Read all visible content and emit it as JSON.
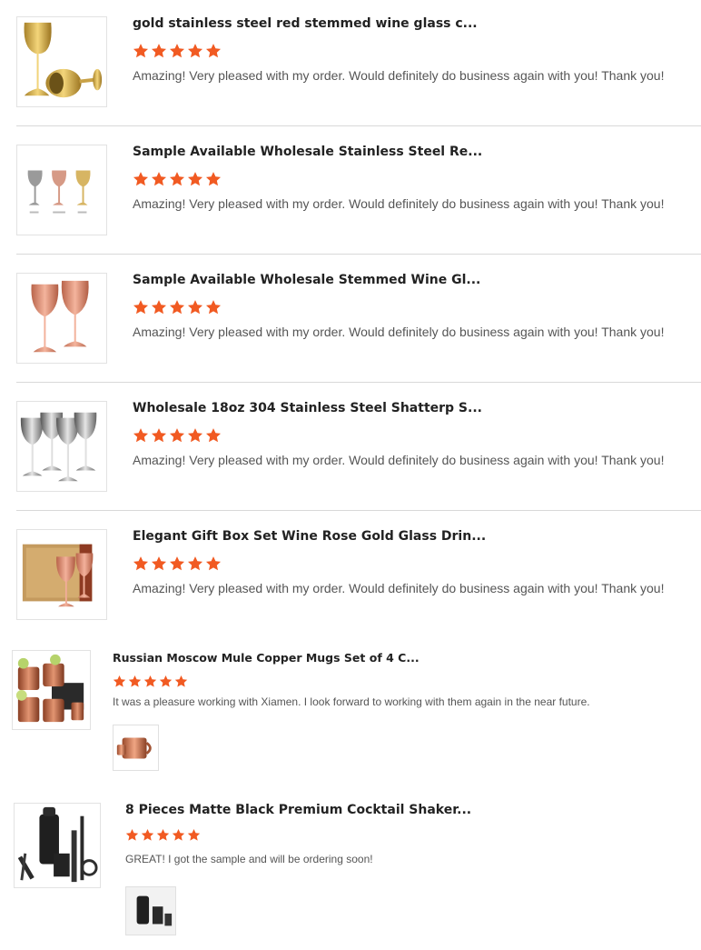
{
  "colors": {
    "star": "#f15a22",
    "divider": "#d9d9d9",
    "title": "#222222",
    "comment": "#555555"
  },
  "reviews": [
    {
      "title": "gold stainless steel red stemmed wine glass c...",
      "rating": 5,
      "comment": "Amazing! Very pleased with my order. Would definitely do business again with you! Thank you!",
      "image": "gold-wine-glasses-image"
    },
    {
      "title": "Sample Available Wholesale Stainless Steel Re...",
      "rating": 5,
      "comment": "Amazing! Very pleased with my order. Would definitely do business again with you! Thank you!",
      "image": "three-wine-glasses-image"
    },
    {
      "title": "Sample Available Wholesale Stemmed Wine Gl...",
      "rating": 5,
      "comment": "Amazing! Very pleased with my order. Would definitely do business again with you! Thank you!",
      "image": "rose-gold-wine-glasses-image"
    },
    {
      "title": "Wholesale 18oz 304 Stainless Steel Shatterp S...",
      "rating": 5,
      "comment": "Amazing! Very pleased with my order. Would definitely do business again with you! Thank you!",
      "image": "silver-wine-glasses-image"
    },
    {
      "title": "Elegant Gift Box Set Wine Rose Gold Glass Drin...",
      "rating": 5,
      "comment": "Amazing! Very pleased with my order. Would definitely do business again with you! Thank you!",
      "image": "gift-box-wine-glasses-image"
    },
    {
      "title": "Russian Moscow Mule Copper Mugs Set of 4 C...",
      "rating": 5,
      "comment": "It was a pleasure working with Xiamen. I look forward to working with them again in the near future.",
      "image": "copper-mugs-image",
      "attachment": "copper-mug-attachment"
    },
    {
      "title": "8 Pieces Matte Black Premium Cocktail Shaker...",
      "rating": 5,
      "comment": "GREAT! I got the sample and will be ordering soon!",
      "image": "cocktail-shaker-set-image",
      "attachment": "shaker-attachment"
    }
  ]
}
